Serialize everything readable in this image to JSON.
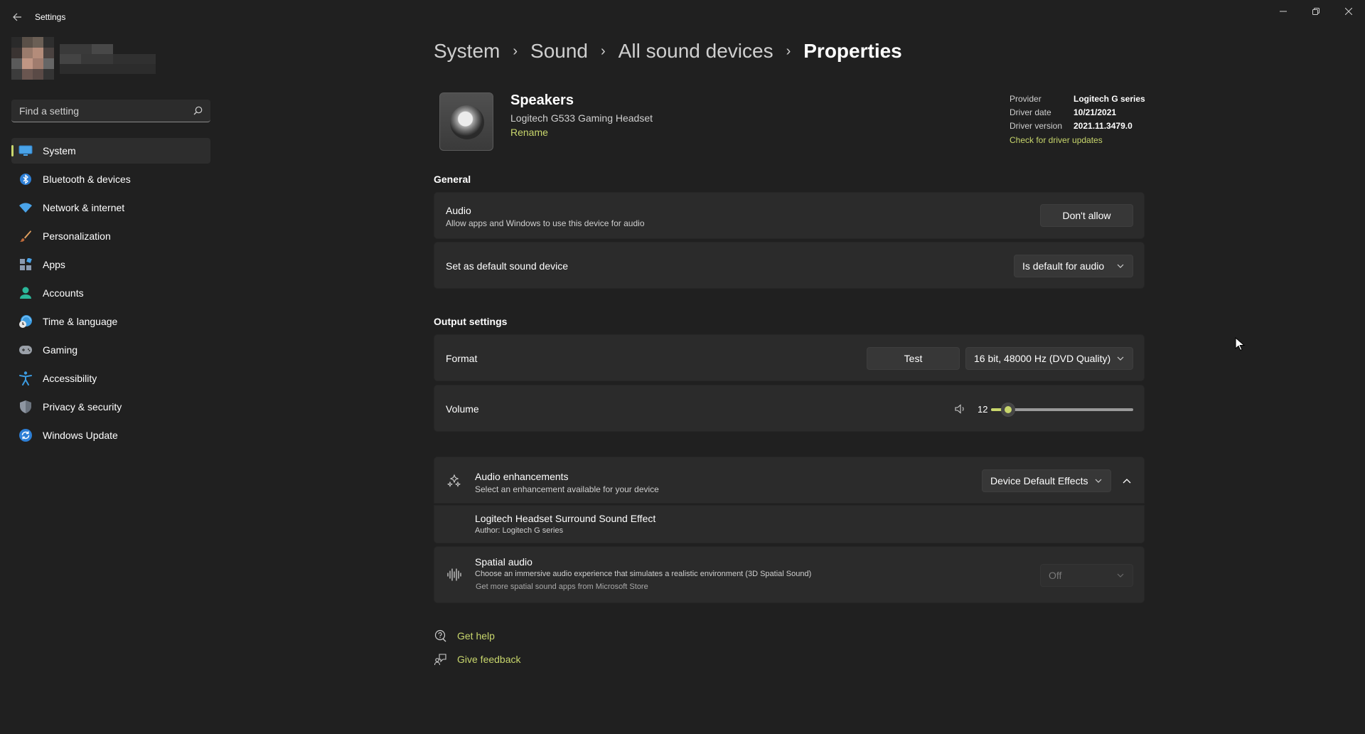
{
  "app": {
    "title": "Settings"
  },
  "search": {
    "placeholder": "Find a setting"
  },
  "nav": {
    "items": [
      {
        "label": "System",
        "icon": "monitor-icon"
      },
      {
        "label": "Bluetooth & devices",
        "icon": "bluetooth-icon"
      },
      {
        "label": "Network & internet",
        "icon": "wifi-icon"
      },
      {
        "label": "Personalization",
        "icon": "brush-icon"
      },
      {
        "label": "Apps",
        "icon": "apps-icon"
      },
      {
        "label": "Accounts",
        "icon": "person-icon"
      },
      {
        "label": "Time & language",
        "icon": "globe-clock-icon"
      },
      {
        "label": "Gaming",
        "icon": "gamepad-icon"
      },
      {
        "label": "Accessibility",
        "icon": "accessibility-icon"
      },
      {
        "label": "Privacy & security",
        "icon": "shield-icon"
      },
      {
        "label": "Windows Update",
        "icon": "update-icon"
      }
    ]
  },
  "breadcrumb": {
    "items": [
      "System",
      "Sound",
      "All sound devices",
      "Properties"
    ],
    "separator": "›"
  },
  "device": {
    "name": "Speakers",
    "model": "Logitech G533 Gaming Headset",
    "rename": "Rename"
  },
  "driver": {
    "provider_label": "Provider",
    "provider": "Logitech G series",
    "date_label": "Driver date",
    "date": "10/21/2021",
    "version_label": "Driver version",
    "version": "2021.11.3479.0",
    "update_link": "Check for driver updates"
  },
  "general": {
    "title": "General",
    "audio": {
      "title": "Audio",
      "desc": "Allow apps and Windows to use this device for audio",
      "button": "Don't allow"
    },
    "default_device": {
      "title": "Set as default sound device",
      "value": "Is default for audio"
    }
  },
  "output": {
    "title": "Output settings",
    "format": {
      "title": "Format",
      "test": "Test",
      "value": "16 bit, 48000 Hz (DVD Quality)"
    },
    "volume": {
      "title": "Volume",
      "value": "12",
      "level": 12
    }
  },
  "enhancements": {
    "title": "Audio enhancements",
    "desc": "Select an enhancement available for your device",
    "value": "Device Default Effects",
    "effect_name": "Logitech Headset Surround Sound Effect",
    "effect_author": "Author: Logitech G series"
  },
  "spatial": {
    "title": "Spatial audio",
    "desc": "Choose an immersive audio experience that simulates a realistic environment (3D Spatial Sound)",
    "link": "Get more spatial sound apps from Microsoft Store",
    "value": "Off"
  },
  "help": {
    "get_help": "Get help",
    "give_feedback": "Give feedback"
  },
  "colors": {
    "accent": "#c8d66c",
    "background": "#202020",
    "card": "#2b2b2b"
  }
}
